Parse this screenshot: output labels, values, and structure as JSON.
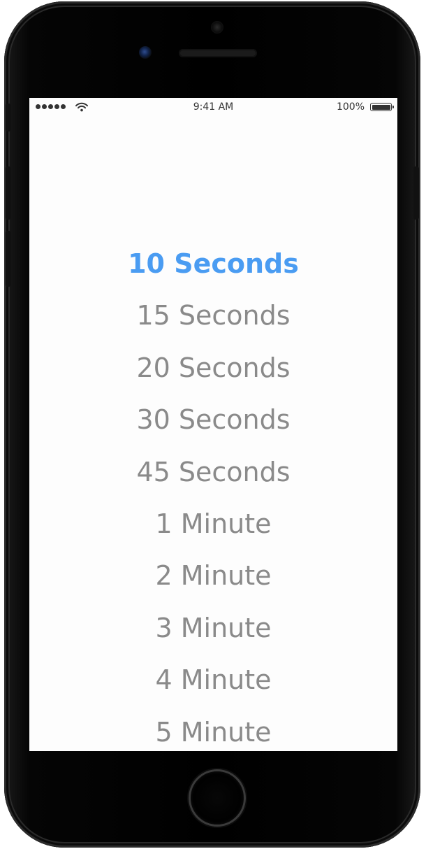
{
  "status_bar": {
    "time": "9:41 AM",
    "battery_percent": "100%"
  },
  "options": [
    {
      "label": "10 Seconds",
      "selected": true
    },
    {
      "label": "15 Seconds",
      "selected": false
    },
    {
      "label": "20 Seconds",
      "selected": false
    },
    {
      "label": "30 Seconds",
      "selected": false
    },
    {
      "label": "45 Seconds",
      "selected": false
    },
    {
      "label": "1 Minute",
      "selected": false
    },
    {
      "label": "2 Minute",
      "selected": false
    },
    {
      "label": "3 Minute",
      "selected": false
    },
    {
      "label": "4 Minute",
      "selected": false
    },
    {
      "label": "5 Minute",
      "selected": false
    }
  ],
  "colors": {
    "selected": "#4a9cf2",
    "unselected": "#8a8a8a",
    "screen_background": "#fdfdfd",
    "device_frame": "#000000"
  },
  "icons": {
    "signal": "cellular-signal-icon",
    "wifi": "wifi-icon",
    "battery": "battery-icon"
  }
}
